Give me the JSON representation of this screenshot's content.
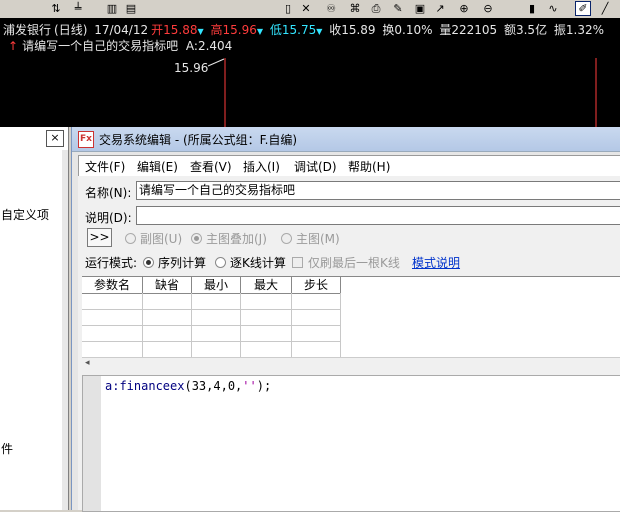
{
  "toolbar": {
    "icons": [
      "sort-icon",
      "chart-icon",
      "bar-chart-icon",
      "page-icon",
      "close-x-icon",
      "binoculars-icon",
      "network-icon",
      "print-icon",
      "note-icon",
      "edit-icon",
      "zoom-in-icon",
      "zoom-out-icon",
      "bars-icon",
      "line-icon",
      "draw-pen-icon",
      "line-tool-icon"
    ]
  },
  "chart": {
    "stock_name": "浦发银行",
    "period": "(日线)",
    "date": "17/04/12",
    "open_label": "开",
    "open_value": "15.88",
    "high_label": "高",
    "high_value": "15.96",
    "low_label": "低",
    "low_value": "15.75",
    "close": "收15.89",
    "turnover": "换0.10%",
    "volume": "量222105",
    "amount": "额3.5亿",
    "amplitude": "振1.32%",
    "indicator_arrow": "↑",
    "indicator_name": "请编写一个自己的交易指标吧",
    "indicator_value": "A:2.404",
    "price_label": "15.96",
    "colors": {
      "up": "#ff3c3c",
      "down": "#33e5ff",
      "text": "#e6e6e6",
      "background": "#000000"
    }
  },
  "left_panel": {
    "close_label": "×",
    "item_custom": "自定义项",
    "item_file": "件"
  },
  "dialog": {
    "title": "交易系统编辑 - (所属公式组：F.自编)",
    "menus": [
      "文件(F)",
      "编辑(E)",
      "查看(V)",
      "插入(I)",
      "调试(D)",
      "帮助(H)"
    ],
    "name_label": "名称(N):",
    "name_value": "请编写一个自己的交易指标吧",
    "desc_label": "说明(D):",
    "desc_value": "",
    "expand_button": ">>",
    "chart_type_options": [
      "副图(U)",
      "主图叠加(J)",
      "主图(M)"
    ],
    "chart_type_selected": "主图叠加(J)",
    "run_mode_label": "运行模式:",
    "run_mode_options": [
      "序列计算",
      "逐K线计算"
    ],
    "run_mode_selected": "序列计算",
    "refresh_last_label": "仅刷最后一根K线",
    "mode_help_link": "模式说明",
    "param_columns": [
      "参数名",
      "缺省",
      "最小",
      "最大",
      "步长"
    ],
    "scroll_left": "◂",
    "code_line": "a:financeex(33,4,0,'');",
    "code_fn": "a:financeex",
    "code_args": "(33,4,0,",
    "code_str": "''",
    "code_end": ");"
  }
}
